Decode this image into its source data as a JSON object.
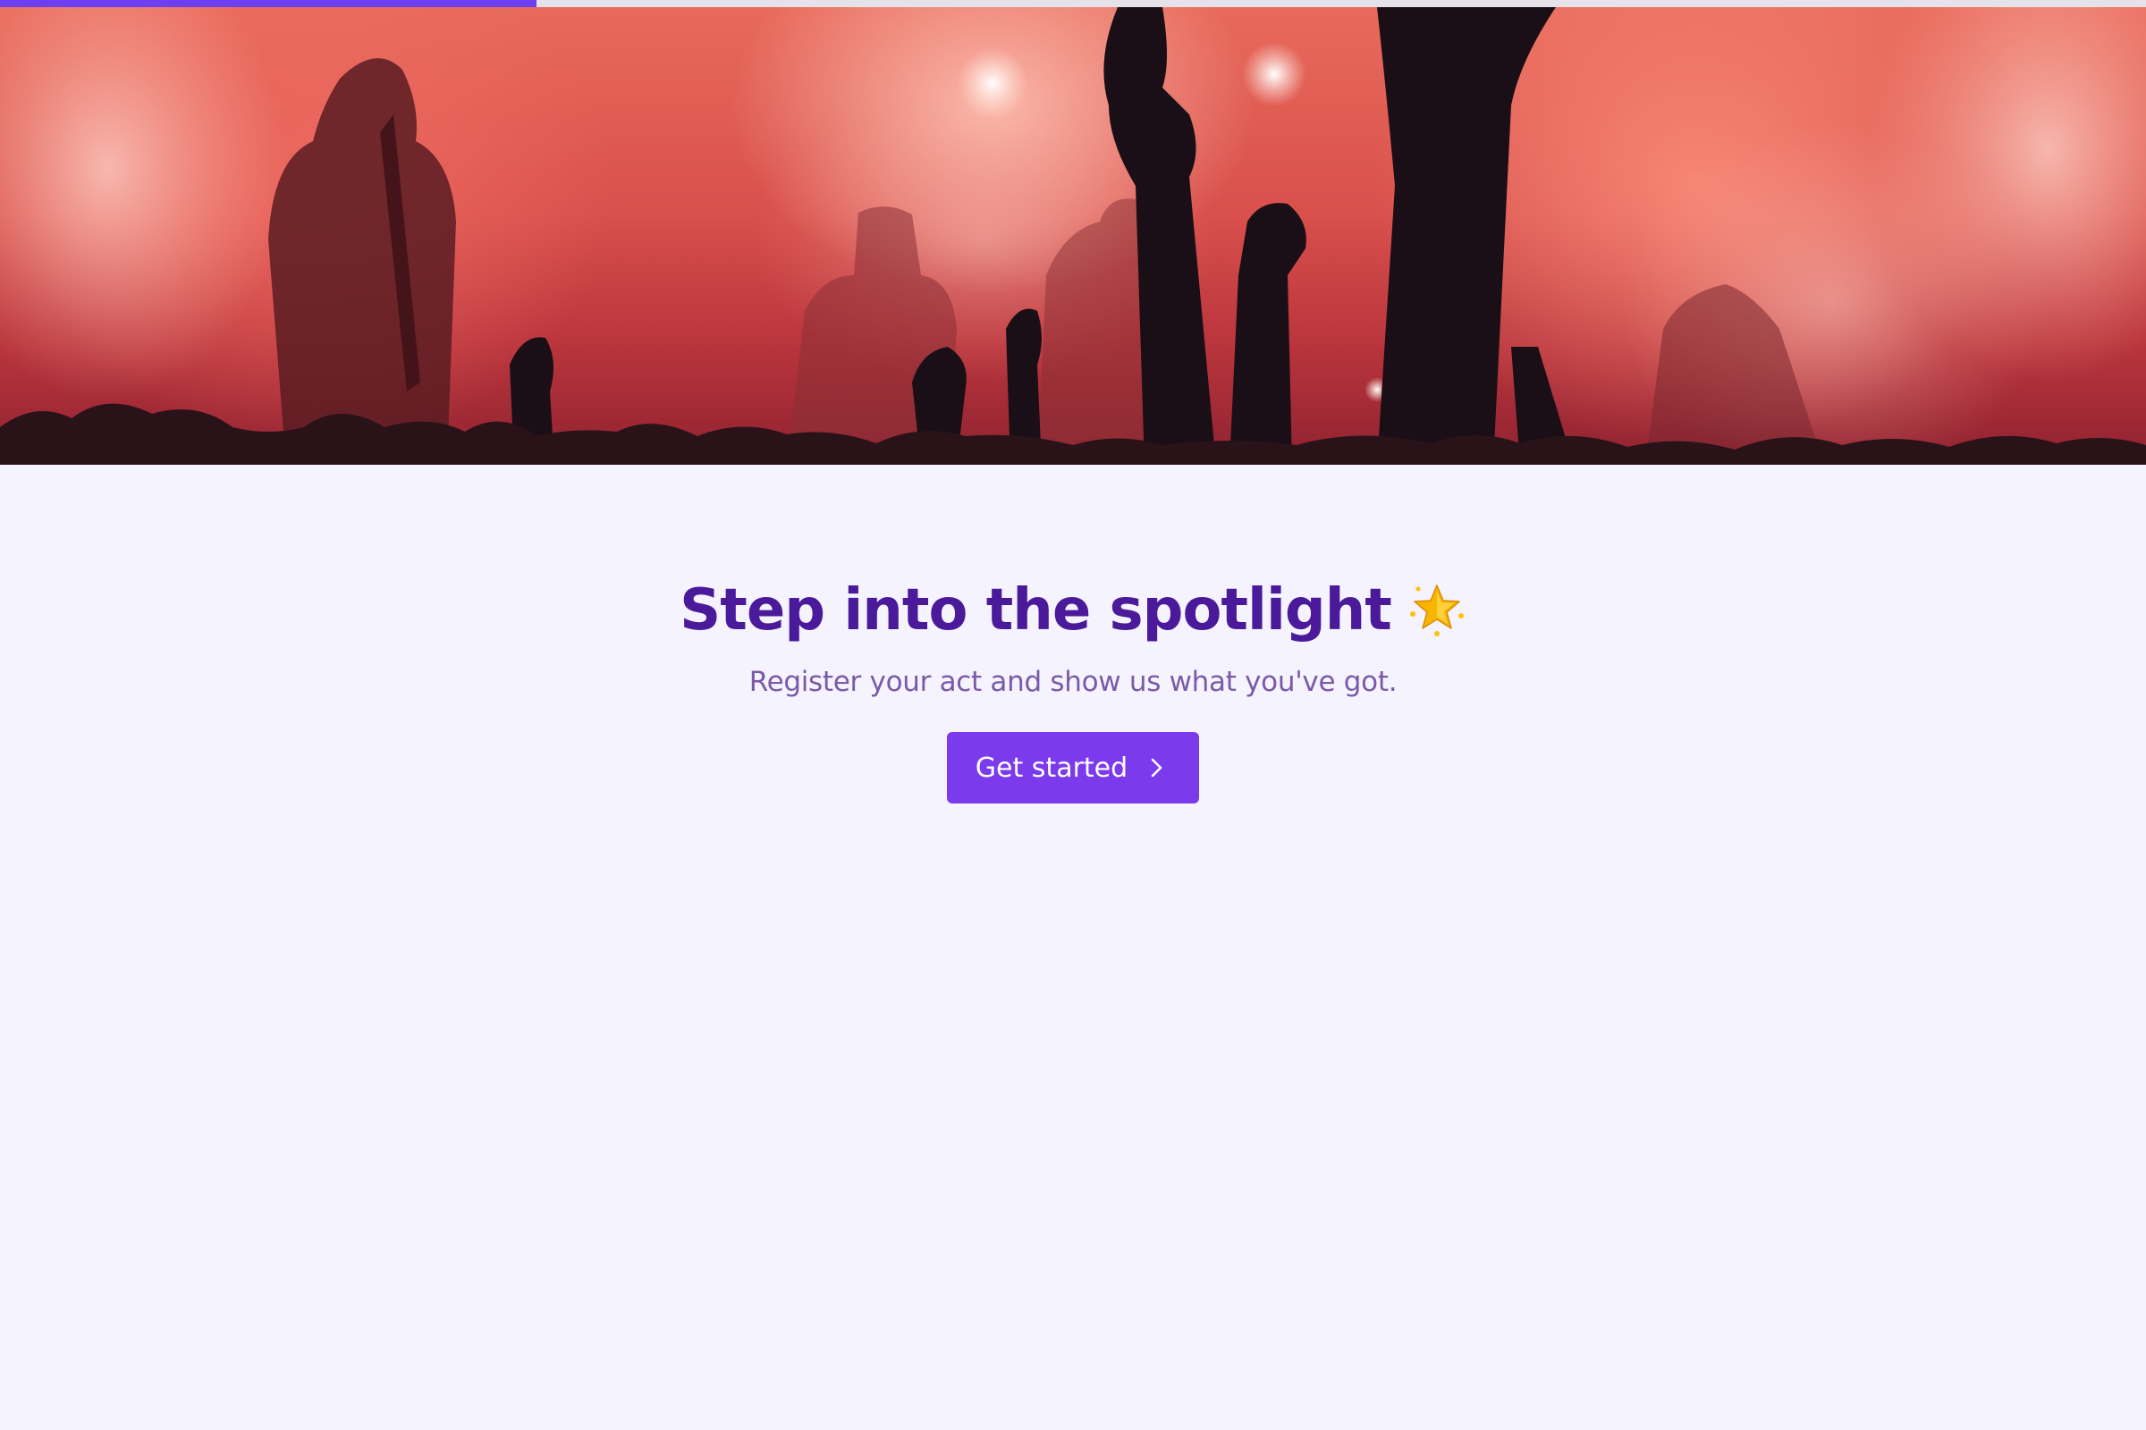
{
  "progress": {
    "value_percent": 25,
    "fill_color": "#6d3ff0",
    "track_color": "#e5e2ea"
  },
  "hero": {
    "description": "concert-crowd-stage-image"
  },
  "main": {
    "headline": "Step into the spotlight",
    "headline_icon": "glowing-star-icon",
    "subtitle": "Register your act and show us what you've got.",
    "cta_label": "Get started",
    "cta_icon": "chevron-right-icon"
  },
  "colors": {
    "background": "#f5f3fe",
    "headline": "#4a1a9a",
    "subtitle": "#7a5aa8",
    "accent": "#7c3aed"
  }
}
